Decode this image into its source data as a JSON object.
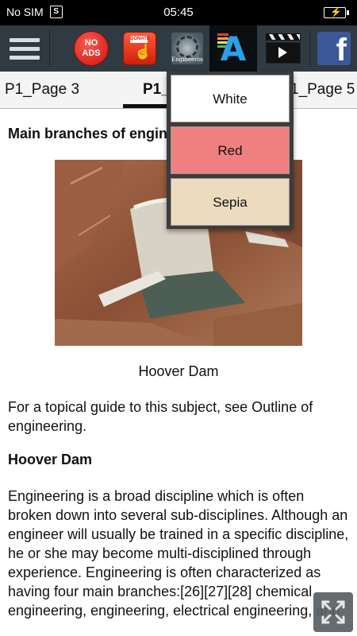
{
  "status_bar": {
    "carrier": "No SIM",
    "sim_badge": "S",
    "time": "05:45"
  },
  "toolbar": {
    "menu_icon": "hamburger-menu-icon",
    "no_ads_label": "NO ADS",
    "donate_label": "DONATE",
    "engineering_icon_label": "Engineering",
    "font_color_icon": "font-color-icon",
    "video_icon": "video-clapper-icon",
    "facebook_label": "f"
  },
  "tabs": {
    "left": "P1_Page 3",
    "current": "P1_",
    "right": "1_Page 5"
  },
  "article": {
    "heading": "Main branches of engin",
    "image_caption": "Hoover Dam",
    "intro": "For a topical guide to this subject, see Outline of engineering.",
    "subheading": "Hoover Dam",
    "body": "Engineering is a broad discipline which is often broken down into several sub-disciplines. Although an engineer will usually be trained in a specific discipline, he or she may become multi-disciplined through experience. Engineering is often characterized as having four main branches:[26][27][28] chemical engineering, engineering, electrical engineering, and"
  },
  "color_menu": {
    "options": [
      "White",
      "Red",
      "Sepia"
    ],
    "colors": {
      "white": "#ffffff",
      "red": "#f08080",
      "sepia": "#ecdcbd"
    }
  },
  "colors": {
    "toolbar": "#2f3a43",
    "accent_blue": "#2aa0e8",
    "facebook": "#3b5998"
  }
}
